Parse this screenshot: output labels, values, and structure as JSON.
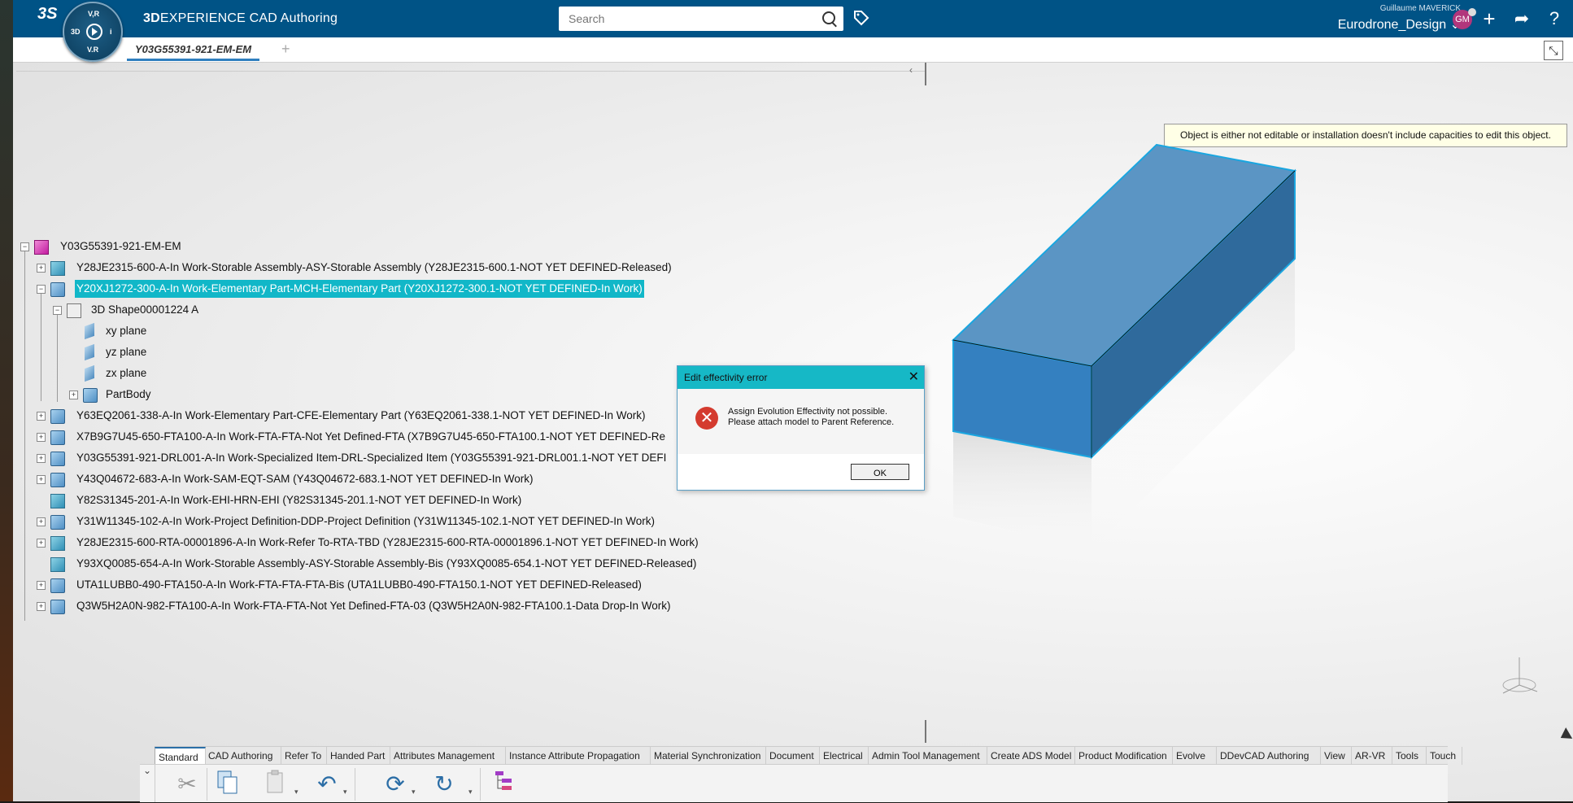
{
  "app": {
    "brand_prefix": "3D",
    "brand_suffix": "EXPERIENCE",
    "app_name": "CAD Authoring",
    "compass": {
      "top": "V,R",
      "left": "3D",
      "right": "i",
      "bottom": "V.R"
    },
    "ds_logo": "3S"
  },
  "search": {
    "placeholder": "Search"
  },
  "user": {
    "name": "Guillaume MAVERICK",
    "initials": "GM",
    "collab_space": "Eurodrone_Design ⌄"
  },
  "tab": {
    "label": "Y03G55391-921-EM-EM",
    "add": "+"
  },
  "tree": {
    "root": "Y03G55391-921-EM-EM",
    "items": [
      {
        "label": "Y28JE2315-600-A-In Work-Storable Assembly-ASY-Storable Assembly (Y28JE2315-600.1-NOT YET DEFINED-Released)"
      },
      {
        "label": "Y20XJ1272-300-A-In Work-Elementary Part-MCH-Elementary Part (Y20XJ1272-300.1-NOT YET DEFINED-In Work)"
      },
      {
        "label": "3D Shape00001224 A"
      },
      {
        "label": "xy plane"
      },
      {
        "label": "yz plane"
      },
      {
        "label": "zx plane"
      },
      {
        "label": "PartBody"
      },
      {
        "label": "Y63EQ2061-338-A-In Work-Elementary Part-CFE-Elementary Part (Y63EQ2061-338.1-NOT YET DEFINED-In Work)"
      },
      {
        "label": "X7B9G7U45-650-FTA100-A-In Work-FTA-FTA-Not Yet Defined-FTA (X7B9G7U45-650-FTA100.1-NOT YET DEFINED-Re"
      },
      {
        "label": "Y03G55391-921-DRL001-A-In Work-Specialized Item-DRL-Specialized Item (Y03G55391-921-DRL001.1-NOT YET DEFI"
      },
      {
        "label": "Y43Q04672-683-A-In Work-SAM-EQT-SAM (Y43Q04672-683.1-NOT YET DEFINED-In Work)"
      },
      {
        "label": "Y82S31345-201-A-In Work-EHI-HRN-EHI (Y82S31345-201.1-NOT YET DEFINED-In Work)"
      },
      {
        "label": "Y31W11345-102-A-In Work-Project Definition-DDP-Project Definition (Y31W11345-102.1-NOT YET DEFINED-In Work)"
      },
      {
        "label": "Y28JE2315-600-RTA-00001896-A-In Work-Refer To-RTA-TBD (Y28JE2315-600-RTA-00001896.1-NOT YET DEFINED-In Work)"
      },
      {
        "label": "Y93XQ0085-654-A-In Work-Storable Assembly-ASY-Storable Assembly-Bis (Y93XQ0085-654.1-NOT YET DEFINED-Released)"
      },
      {
        "label": "UTA1LUBB0-490-FTA150-A-In Work-FTA-FTA-FTA-Bis (UTA1LUBB0-490-FTA150.1-NOT YET DEFINED-Released)"
      },
      {
        "label": "Q3W5H2A0N-982-FTA100-A-In Work-FTA-FTA-Not Yet Defined-FTA-03 (Q3W5H2A0N-982-FTA100.1-Data Drop-In Work)"
      }
    ]
  },
  "dialog": {
    "title": "Edit effectivity error",
    "line1": "Assign Evolution Effectivity not possible.",
    "line2": "Please attach model to Parent Reference.",
    "ok": "OK",
    "close": "✕",
    "icon": "✕"
  },
  "tooltip": "Object is either not editable or installation doesn't include capacities to edit this object.",
  "ribbon_tabs": [
    "Standard",
    "CAD Authoring",
    "Refer To",
    "Handed Part",
    "Attributes Management",
    "Instance Attribute Propagation",
    "Material Synchronization",
    "Document",
    "Electrical",
    "Admin Tool Management",
    "Create ADS Model",
    "Product Modification",
    "Evolve",
    "DDevCAD Authoring",
    "View",
    "AR-VR",
    "Tools",
    "Touch"
  ],
  "ribbon_icons": [
    "scissors-icon",
    "copy-icon",
    "paste-icon",
    "undo-icon",
    "update-icon",
    "refresh-icon",
    "tree-icon"
  ],
  "colors": {
    "accent": "#005386",
    "selection": "#11b7c8",
    "dialog_title": "#16b8c6",
    "error": "#d43b2f",
    "model": "#3b86c4"
  }
}
